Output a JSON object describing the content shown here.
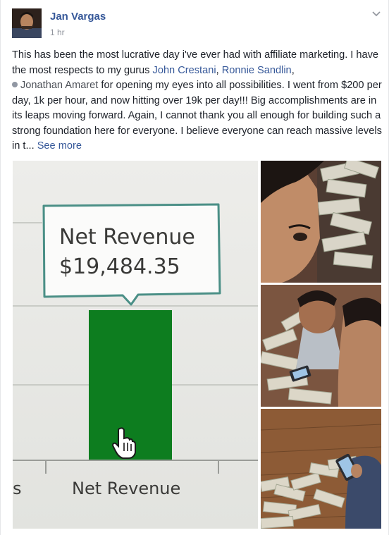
{
  "post": {
    "author": "Jan Vargas",
    "timestamp": "1 hr",
    "menu_icon": "chevron-down-icon",
    "text": {
      "p1": "This has been the most lucrative day i've ever had with affiliate marketing. I have the most respects to my gurus ",
      "mention1": "John Crestani",
      "sep1": ", ",
      "mention2": "Ronnie Sandlin",
      "sep2": ",",
      "mention3": "Jonathan Amaret",
      "p2": " for opening my eyes into all possibilities. I went from $200 per day, 1k per hour, and now hitting over 19k per day!!! Big accomplishments are in its leaps moving forward. Again, I cannot thank you all enough for building such a strong foundation here for everyone. I believe everyone can reach massive levels in t...",
      "see_more": "See more"
    },
    "photos": {
      "main": {
        "tooltip_title": "Net Revenue",
        "tooltip_value": "$19,484.35",
        "axis_label": "Net Revenue",
        "axis_label_left": "s",
        "bar_color": "#0d7d1f"
      }
    }
  }
}
